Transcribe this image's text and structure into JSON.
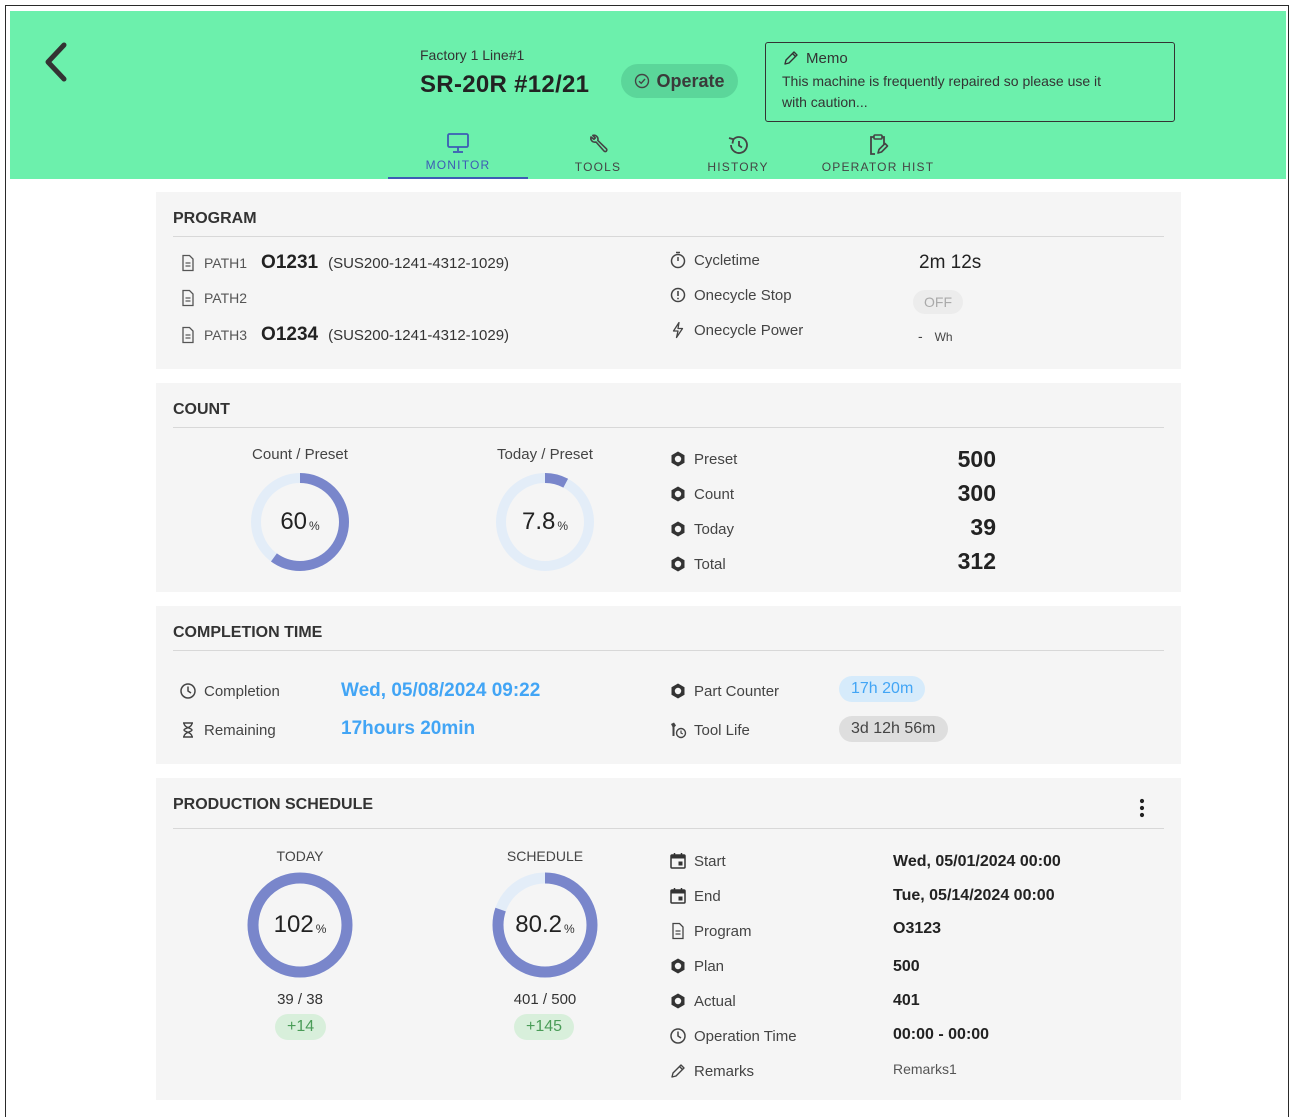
{
  "header": {
    "factory_line": "Factory 1 Line#1",
    "machine_name": "SR-20R #12/21",
    "status": "Operate",
    "memo": {
      "title": "Memo",
      "text_line1": "This machine is frequently repaired so please use it",
      "text_line2": "with caution..."
    },
    "tabs": [
      {
        "label": "MONITOR",
        "icon": "monitor-icon",
        "active": true
      },
      {
        "label": "TOOLS",
        "icon": "wrench-icon",
        "active": false
      },
      {
        "label": "HISTORY",
        "icon": "history-icon",
        "active": false
      },
      {
        "label": "OPERATOR HIST",
        "icon": "clipboard-edit-icon",
        "active": false
      }
    ]
  },
  "program": {
    "title": "PROGRAM",
    "paths": [
      {
        "label": "PATH1",
        "number": "O1231",
        "sub": "(SUS200-1241-4312-1029)"
      },
      {
        "label": "PATH2",
        "number": "",
        "sub": ""
      },
      {
        "label": "PATH3",
        "number": "O1234",
        "sub": "(SUS200-1241-4312-1029)"
      }
    ],
    "cycletime_label": "Cycletime",
    "cycletime_value": "2m 12s",
    "onecycle_stop_label": "Onecycle Stop",
    "onecycle_stop_value": "OFF",
    "onecycle_power_label": "Onecycle Power",
    "onecycle_power_value": "-",
    "onecycle_power_unit": "Wh"
  },
  "count": {
    "title": "COUNT",
    "gauge1": {
      "label": "Count / Preset",
      "value": "60",
      "unit": "%",
      "fraction": 0.6
    },
    "gauge2": {
      "label": "Today / Preset",
      "value": "7.8",
      "unit": "%",
      "fraction": 0.078
    },
    "preset_label": "Preset",
    "preset_value": "500",
    "count_label": "Count",
    "count_value": "300",
    "today_label": "Today",
    "today_value": "39",
    "total_label": "Total",
    "total_value": "312"
  },
  "completion": {
    "title": "COMPLETION TIME",
    "completion_label": "Completion",
    "completion_value": "Wed, 05/08/2024 09:22",
    "remaining_label": "Remaining",
    "remaining_value": "17hours 20min",
    "part_counter_label": "Part Counter",
    "part_counter_value": "17h 20m",
    "tool_life_label": "Tool Life",
    "tool_life_value": "3d 12h 56m"
  },
  "schedule": {
    "title": "PRODUCTION SCHEDULE",
    "today": {
      "label": "TODAY",
      "value": "102",
      "unit": "%",
      "fraction": 1.0,
      "ratio": "39 / 38",
      "delta": "+14"
    },
    "schedule": {
      "label": "SCHEDULE",
      "value": "80.2",
      "unit": "%",
      "fraction": 0.802,
      "ratio": "401 / 500",
      "delta": "+145"
    },
    "start_label": "Start",
    "start_value": "Wed, 05/01/2024 00:00",
    "end_label": "End",
    "end_value": "Tue, 05/14/2024 00:00",
    "program_label": "Program",
    "program_value": "O3123",
    "plan_label": "Plan",
    "plan_value": "500",
    "actual_label": "Actual",
    "actual_value": "401",
    "optime_label": "Operation Time",
    "optime_value": "00:00 - 00:00",
    "remarks_label": "Remarks",
    "remarks_value": "Remarks1"
  },
  "colors": {
    "header_bg": "#6cf0ac",
    "accent_blue": "#3d5bb5",
    "gauge_fill": "#7986cb",
    "gauge_track": "#e3edf8",
    "link_blue": "#42a5f5"
  }
}
